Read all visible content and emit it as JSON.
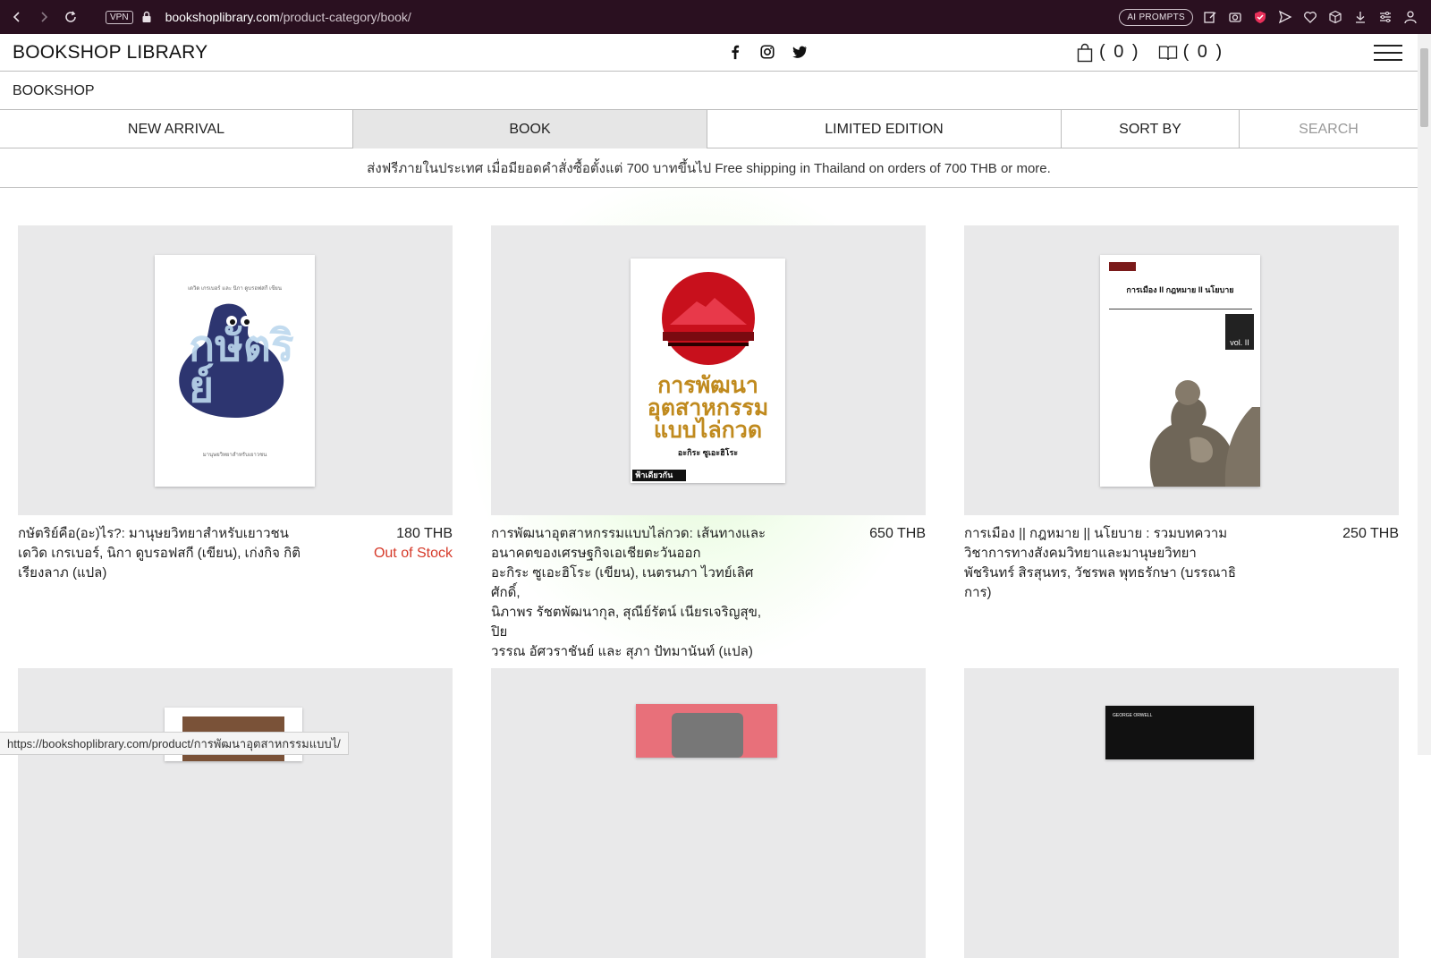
{
  "browser": {
    "vpn_label": "VPN",
    "url_domain": "bookshoplibrary.com",
    "url_path": "/product-category/book/",
    "ai_prompts_label": "AI PROMPTS"
  },
  "header": {
    "logo": "BOOKSHOP LIBRARY",
    "cart_count": "( 0 )",
    "wishlist_count": "( 0 )"
  },
  "sub_header": {
    "label": "BOOKSHOP"
  },
  "menu": {
    "items": [
      "NEW ARRIVAL",
      "BOOK",
      "LIMITED EDITION",
      "SORT BY",
      "SEARCH"
    ],
    "active": "BOOK"
  },
  "shipping_notice": "ส่งฟรีภายในประเทศ เมื่อมียอดคำสั่งซื้อตั้งแต่ 700 บาทขึ้นไป Free shipping in Thailand on orders of 700 THB or more.",
  "products": [
    {
      "title_line1": "กษัตริย์คือ(อะ)ไร?: มานุษยวิทยาสำหรับเยาวชน",
      "title_line2": "เดวิด เกรเบอร์, นิกา ดูบรอฟสกี (เขียน), เก่งกิจ กิติ",
      "title_line3": "เรียงลาภ (แปล)",
      "price": "180 THB",
      "status": "Out of Stock",
      "cover_text_top": "เดวิด เกรเบอร์ และ นิกา ดูบรอฟสกี เขียน",
      "cover_big": "กษัตริย์",
      "cover_bottom": "มานุษยวิทยาสำหรับเยาวชน"
    },
    {
      "title_line1": "การพัฒนาอุตสาหกรรมแบบไล่กวด: เส้นทางและ",
      "title_line2": "อนาคตของเศรษฐกิจเอเชียตะวันออก",
      "title_line3": "อะกิระ ซูเอะฮิโระ (เขียน), เนตรนภา ไวทย์เลิศศักดิ์,",
      "title_line4": "นิภาพร รัชตพัฒนากุล, สุณีย์รัตน์ เนียรเจริญสุข, ปิย",
      "title_line5": "วรรณ อัศวราชันย์ และ สุภา ปัทมานันท์ (แปล)",
      "price": "650 THB",
      "cover_title": "การพัฒนา อุตสาหกรรม แบบไล่กวด",
      "cover_author": "อะกิระ ซูเอะฮิโระ",
      "cover_publisher": "ฟ้าเดียวกัน"
    },
    {
      "title_line1": "การเมือง || กฎหมาย || นโยบาย : รวมบทความ",
      "title_line2": "วิชาการทางสังคมวิทยาและมานุษยวิทยา",
      "title_line3": "พัชรินทร์ สิรสุนทร, วัชรพล พุทธรักษา (บรรณาธิ",
      "title_line4": "การ)",
      "price": "250 THB",
      "cover_title": "การเมือง II กฎหมาย II นโยบาย",
      "cover_vol": "vol. II"
    }
  ],
  "bottom_cover_text": "GEORGE ORWELL",
  "status_url": "https://bookshoplibrary.com/product/การพัฒนาอุตสาหกรรมแบบไ/"
}
